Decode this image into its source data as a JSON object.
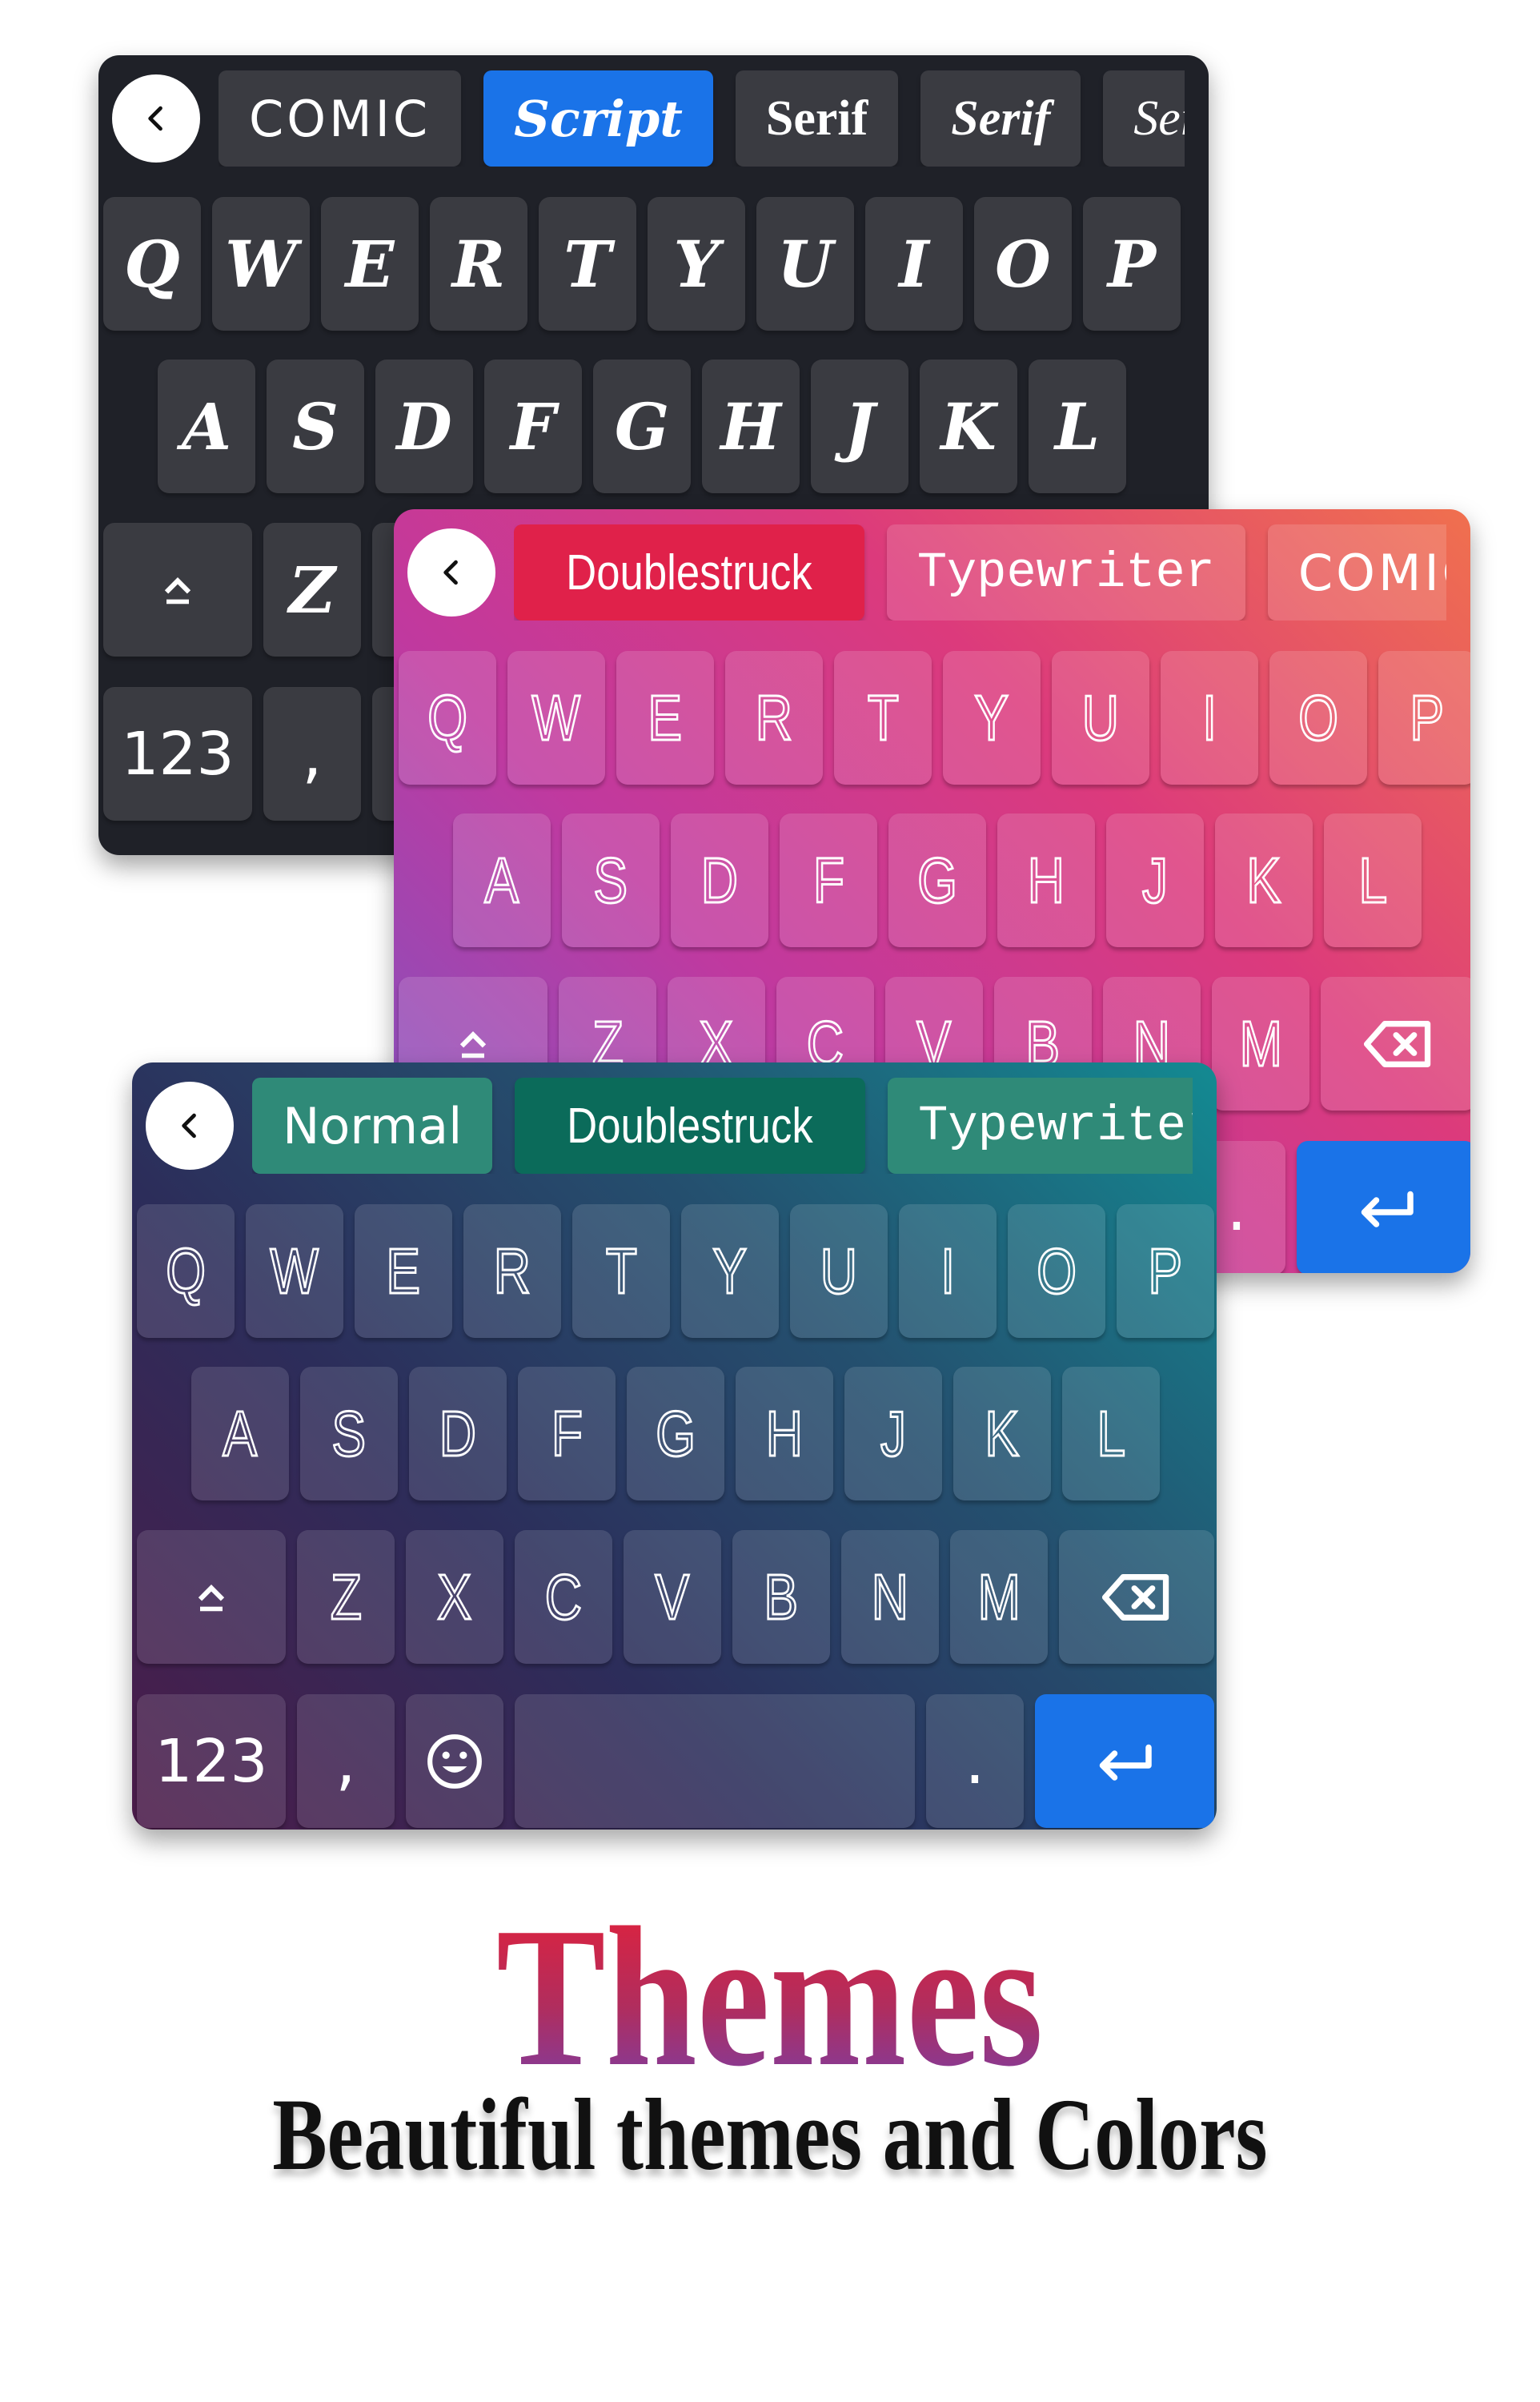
{
  "keyboards": [
    {
      "name": "dark-script-keyboard",
      "letter_font": "script",
      "chips": [
        {
          "label": "COMIC",
          "font": "comic",
          "selected": false
        },
        {
          "label": "Script",
          "font": "script",
          "selected": true
        },
        {
          "label": "Serif",
          "font": "serif",
          "selected": false
        },
        {
          "label": "Serif",
          "font": "serif-i",
          "selected": false
        },
        {
          "label": "Serif",
          "font": "serif-i2",
          "selected": false
        }
      ],
      "rows": [
        [
          "Q",
          "W",
          "E",
          "R",
          "T",
          "Y",
          "U",
          "I",
          "O",
          "P"
        ],
        [
          "A",
          "S",
          "D",
          "F",
          "G",
          "H",
          "J",
          "K",
          "L"
        ],
        [
          "Z",
          null,
          null,
          null,
          null,
          null,
          null
        ],
        null
      ],
      "has_backspace": false,
      "bottom": {
        "numbers": "123",
        "comma": ",",
        "emoji": false,
        "period": null,
        "enter": false
      }
    },
    {
      "name": "pink-doublestruck-keyboard",
      "letter_font": "double",
      "chips": [
        {
          "label": "Doublestruck",
          "font": "double",
          "selected": true
        },
        {
          "label": "Typewriter",
          "font": "type",
          "selected": false
        },
        {
          "label": "COMIC",
          "font": "comic",
          "selected": false
        }
      ],
      "rows": [
        [
          "Q",
          "W",
          "E",
          "R",
          "T",
          "Y",
          "U",
          "I",
          "O",
          "P"
        ],
        [
          "A",
          "S",
          "D",
          "F",
          "G",
          "H",
          "J",
          "K",
          "L"
        ],
        [
          "Z",
          "X",
          "C",
          "V",
          "B",
          "N",
          "M"
        ],
        null
      ],
      "has_backspace": true,
      "bottom": {
        "numbers": null,
        "comma": null,
        "emoji": false,
        "period": ".",
        "enter": true
      }
    },
    {
      "name": "teal-doublestruck-keyboard",
      "letter_font": "double",
      "chips": [
        {
          "label": "Normal",
          "font": "normal",
          "selected": false
        },
        {
          "label": "Doublestruck",
          "font": "double",
          "selected": true
        },
        {
          "label": "Typewriter",
          "font": "type",
          "selected": false
        }
      ],
      "rows": [
        [
          "Q",
          "W",
          "E",
          "R",
          "T",
          "Y",
          "U",
          "I",
          "O",
          "P"
        ],
        [
          "A",
          "S",
          "D",
          "F",
          "G",
          "H",
          "J",
          "K",
          "L"
        ],
        [
          "Z",
          "X",
          "C",
          "V",
          "B",
          "N",
          "M"
        ],
        null
      ],
      "has_backspace": true,
      "bottom": {
        "numbers": "123",
        "comma": ",",
        "emoji": true,
        "period": ".",
        "enter": true
      }
    }
  ],
  "icons": {
    "back": "chevron-left-icon",
    "shift": "shift-icon",
    "backspace": "backspace-icon",
    "emoji": "emoji-icon",
    "enter": "enter-icon"
  },
  "colors": {
    "accent_blue": "#1a73e8",
    "pink_selected": "#e0214a",
    "teal_selected": "#0b6b5a",
    "title_top": "#e3213a",
    "title_bottom": "#7a3ea6"
  },
  "headline": {
    "title": "Themes",
    "subtitle": "Beautiful themes and Colors"
  }
}
